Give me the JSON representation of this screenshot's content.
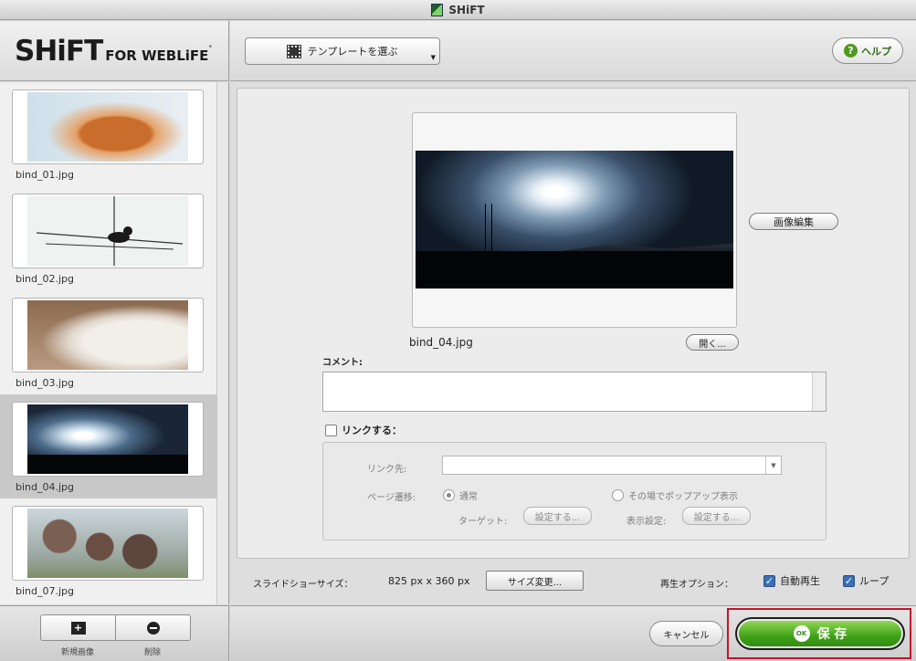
{
  "window": {
    "title": "SHiFT"
  },
  "brand": {
    "name": "SHiFT",
    "suffix": "FOR WEBLiFE",
    "mark": "*"
  },
  "toolbar": {
    "template_label": "テンプレートを選ぶ",
    "help_label": "ヘルプ",
    "help_glyph": "?"
  },
  "sidebar": {
    "items": [
      {
        "label": "bind_01.jpg"
      },
      {
        "label": "bind_02.jpg"
      },
      {
        "label": "bind_03.jpg"
      },
      {
        "label": "bind_04.jpg",
        "selected": true
      },
      {
        "label": "bind_07.jpg"
      }
    ],
    "new_label": "新規画像",
    "new_glyph": "+",
    "delete_label": "削除"
  },
  "editor": {
    "edit_image_label": "画像編集",
    "file_name": "bind_04.jpg",
    "open_label": "開く...",
    "comment_label": "コメント:",
    "comment_value": "",
    "link_label": "リンクする：",
    "link_target_label": "リンク先:",
    "link_target_value": "",
    "page_transition_label": "ページ遷移:",
    "radio_normal": "通常",
    "radio_popup": "その場でポップアップ表示",
    "target_label": "ターゲット:",
    "target_button": "設定する...",
    "display_label": "表示設定:",
    "display_button": "設定する..."
  },
  "slideshow": {
    "size_label": "スライドショーサイズ：",
    "size_value": "825 px x 360 px",
    "resize_label": "サイズ変更...",
    "play_options_label": "再生オプション：",
    "autoplay_label": "自動再生",
    "autoplay_checked": true,
    "loop_label": "ループ",
    "loop_checked": true
  },
  "footer": {
    "cancel_label": "キャンセル",
    "ok_glyph": "OK",
    "save_label": "保 存"
  },
  "colors": {
    "accent_green": "#3fa017",
    "highlight_red": "#c4142c",
    "check_blue": "#3b6fb6"
  }
}
